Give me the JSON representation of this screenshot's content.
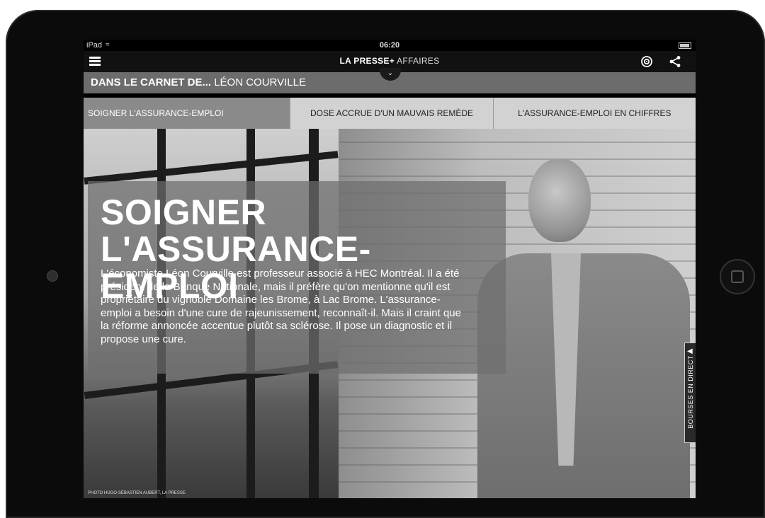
{
  "status_bar": {
    "device": "iPad",
    "time": "06:20"
  },
  "nav": {
    "brand": "LA PRESSE+",
    "section": "AFFAIRES"
  },
  "carnet": {
    "prefix": "DANS LE CARNET DE...",
    "name": "LÉON COURVILLE"
  },
  "tabs": [
    {
      "label": "SOIGNER L'ASSURANCE-EMPLOI",
      "active": true
    },
    {
      "label": "DOSE ACCRUE D'UN MAUVAIS REMÈDE",
      "active": false
    },
    {
      "label": "L'ASSURANCE-EMPLOI EN CHIFFRES",
      "active": false
    }
  ],
  "article": {
    "headline_line1": "SOIGNER",
    "headline_line2": "L'ASSURANCE-EMPLOI",
    "intro": "L'économiste Léon Courville est professeur associé à HEC Montréal. Il a été président de la Banque Nationale, mais il préfère qu'on mentionne qu'il est propriétaire du vignoble Domaine les Brome, à Lac Brome. L'assurance-emploi a besoin d'une cure de rajeunissement, reconnaît-il. Mais il craint que la réforme annoncée accentue plutôt sa sclérose.  Il pose un diagnostic et il propose une cure.",
    "photo_credit": "PHOTO HUGO-SÉBASTIEN AUBERT, LA PRESSE"
  },
  "side_tab": {
    "label": "BOURSES EN DIRECT"
  },
  "icons": {
    "menu": "hamburger-icon",
    "podcast": "podcast-icon",
    "share": "share-icon",
    "pull_down": "chevron-down-icon",
    "side_chevron": "chevron-left-icon"
  }
}
